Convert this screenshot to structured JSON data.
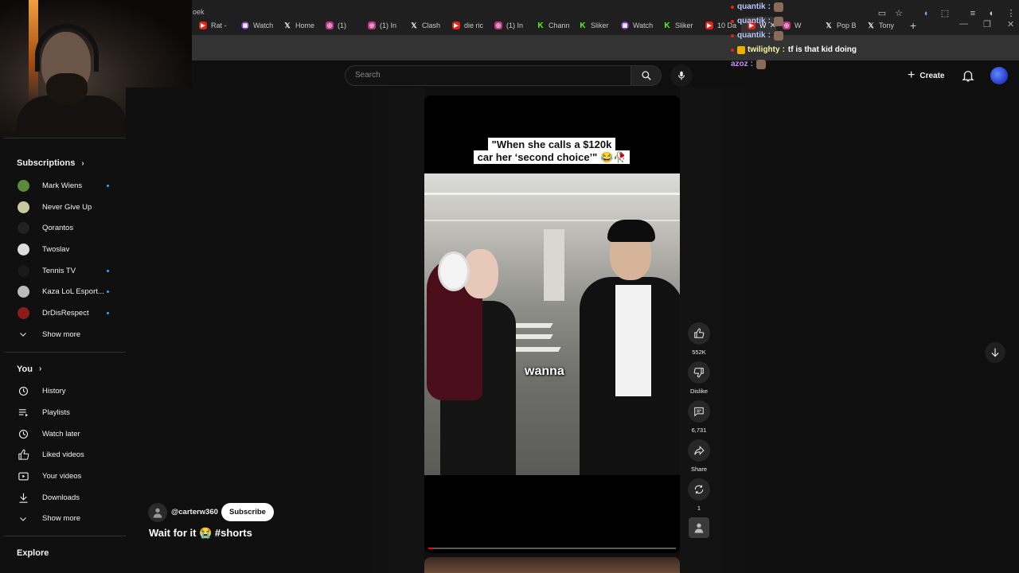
{
  "browser": {
    "tabs": [
      {
        "label": "Rat - ",
        "icon": "youtube-icon"
      },
      {
        "label": "Watch",
        "icon": "twitch-icon"
      },
      {
        "label": "Home",
        "icon": "x-icon"
      },
      {
        "label": "(1)",
        "icon": "instagram-icon"
      },
      {
        "label": "(1) In",
        "icon": "instagram-icon"
      },
      {
        "label": "Clash",
        "icon": "x-icon"
      },
      {
        "label": "die ric",
        "icon": "youtube-icon"
      },
      {
        "label": "(1) In",
        "icon": "instagram-icon"
      },
      {
        "label": "Chann",
        "icon": "kick-icon"
      },
      {
        "label": "Sliker",
        "icon": "kick-icon"
      },
      {
        "label": "Watch",
        "icon": "twitch-icon"
      },
      {
        "label": "Sliker",
        "icon": "kick-icon"
      },
      {
        "label": "10 Da",
        "icon": "youtube-icon"
      },
      {
        "label": "W",
        "icon": "instagram-icon"
      },
      {
        "label": "Pop B",
        "icon": "x-icon"
      },
      {
        "label": "Tony",
        "icon": "x-icon"
      }
    ],
    "active_tab": {
      "label": "W",
      "icon": "youtube-icon"
    },
    "address_fragment": "oek"
  },
  "chat": [
    {
      "user": "quantik",
      "sep": ":",
      "msg": "",
      "emote": true,
      "badge": false
    },
    {
      "user": "quantik",
      "sep": ":",
      "msg": "",
      "emote": true,
      "badge": false
    },
    {
      "user": "quantik",
      "sep": ":",
      "msg": "",
      "emote": true,
      "badge": false
    },
    {
      "user": "twilighty",
      "sep": ":",
      "msg": "tf is that kid doing",
      "emote": false,
      "badge": true
    },
    {
      "user": "azoz",
      "sep": ":",
      "msg": "",
      "emote": true,
      "badge": false
    }
  ],
  "header": {
    "search_placeholder": "Search",
    "create_label": "Create"
  },
  "sidebar": {
    "subscriptions_title": "Subscriptions",
    "subscriptions": [
      {
        "name": "Mark Wiens",
        "live": true,
        "color": "#5a8a3a"
      },
      {
        "name": "Never Give Up",
        "live": false,
        "color": "#c9c9a0"
      },
      {
        "name": "Qorantos",
        "live": false,
        "color": "#222222"
      },
      {
        "name": "Twoslav",
        "live": false,
        "color": "#dddddd"
      },
      {
        "name": "Tennis TV",
        "live": true,
        "color": "#1a1a1a"
      },
      {
        "name": "Kaza LoL Esport...",
        "live": true,
        "color": "#bbbbbb"
      },
      {
        "name": "DrDisRespect",
        "live": true,
        "color": "#8a1c1c"
      }
    ],
    "show_more_1": "Show more",
    "you_title": "You",
    "you_items": [
      {
        "label": "History",
        "icon": "history-icon"
      },
      {
        "label": "Playlists",
        "icon": "playlists-icon"
      },
      {
        "label": "Watch later",
        "icon": "watch-later-icon"
      },
      {
        "label": "Liked videos",
        "icon": "like-icon"
      },
      {
        "label": "Your videos",
        "icon": "your-videos-icon"
      },
      {
        "label": "Downloads",
        "icon": "download-icon"
      }
    ],
    "show_more_2": "Show more",
    "explore_title": "Explore"
  },
  "short": {
    "caption_line1": "\"When she calls a $120k",
    "caption_line2": "car her ‘second choice’\" 😂🥀",
    "subtitle": "wanna",
    "progress": 0.02,
    "channel": "@carterw360",
    "subscribe_label": "Subscribe",
    "title": "Wait for it 😭 #shorts"
  },
  "actions": {
    "likes": "552K",
    "dislike_label": "Dislike",
    "comments": "6,731",
    "share_label": "Share",
    "remix_count": "1"
  },
  "colors": {
    "accent": "#ff0000",
    "live_dot": "#3ea6ff",
    "background": "#0f0f0f"
  }
}
